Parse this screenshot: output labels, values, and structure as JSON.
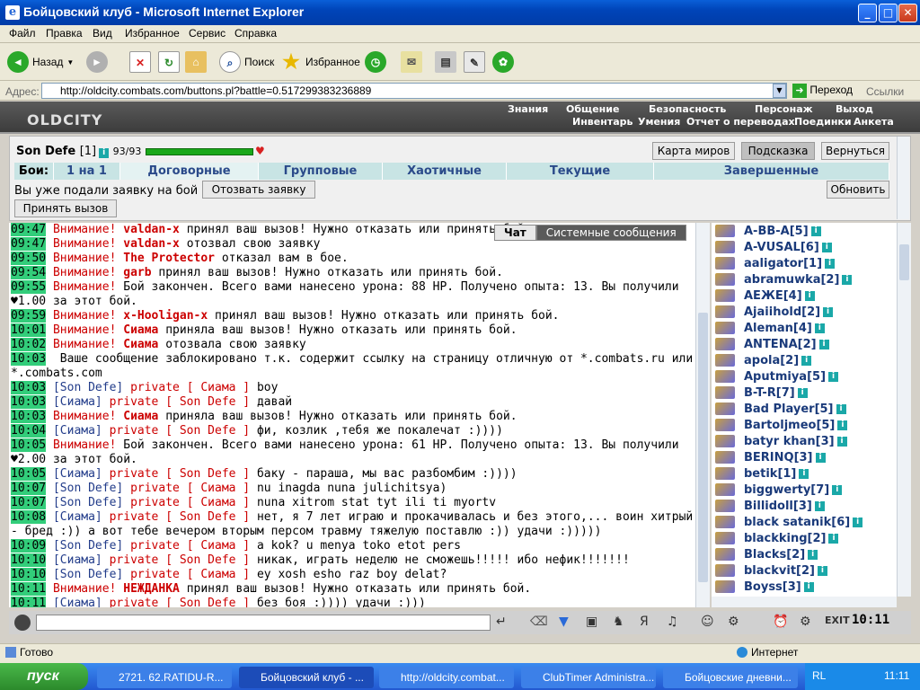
{
  "window": {
    "title": "Бойцовский клуб - Microsoft Internet Explorer"
  },
  "menu": [
    "Файл",
    "Правка",
    "Вид",
    "Избранное",
    "Сервис",
    "Справка"
  ],
  "toolbar": {
    "back": "Назад",
    "search": "Поиск",
    "favorites": "Избранное"
  },
  "address": {
    "label": "Адрес:",
    "url": "http://oldcity.combats.com/buttons.pl?battle=0.517299383236889",
    "go": "Переход",
    "links": "Ссылки"
  },
  "game": {
    "logo": "OLDCITY",
    "nav1": [
      "Знания",
      "Общение",
      "Безопасность",
      "Персонаж",
      "Выход"
    ],
    "nav2": [
      "Инвентарь",
      "Умения",
      "Отчет о переводах",
      "Поединки",
      "Анкета"
    ]
  },
  "player": {
    "name": "Son Defe",
    "level": "[1]",
    "hp": "93/93",
    "hp_fraction": 1.0
  },
  "buttons": {
    "map": "Карта миров",
    "hint": "Подсказка",
    "back": "Вернуться",
    "refresh": "Обновить",
    "withdraw": "Отозвать заявку",
    "accept": "Принять вызов"
  },
  "tabs": {
    "label": "Бои:",
    "items": [
      "1 на 1",
      "Договорные",
      "Групповые",
      "Хаотичные",
      "Текущие",
      "Завершенные"
    ]
  },
  "notice": "Вы уже подали заявку на бой",
  "chattabs": {
    "chat": "Чат",
    "system": "Системные сообщения"
  },
  "chat": [
    {
      "t": "09:47",
      "w": "Внимание!",
      "n": "valdan-x",
      "m": " принял ваш вызов! Нужно отказать или принять бой."
    },
    {
      "t": "09:47",
      "w": "Внимание!",
      "n": "valdan-x",
      "m": " отозвал свою заявку"
    },
    {
      "t": "09:50",
      "w": "Внимание!",
      "n": "The Protector",
      "m": " отказал вам в бое."
    },
    {
      "t": "09:54",
      "w": "Внимание!",
      "n": "garb",
      "m": " принял ваш вызов! Нужно отказать или принять бой."
    },
    {
      "t": "09:55",
      "w": "Внимание!",
      "n": "",
      "m": " Бой закончен. Всего вами нанесено урона: 88 HP. Получено опыта: 13. Вы получили ♥1.00 за этот бой."
    },
    {
      "t": "09:59",
      "w": "Внимание!",
      "n": "x-Hooligan-x",
      "m": " принял ваш вызов! Нужно отказать или принять бой."
    },
    {
      "t": "10:01",
      "w": "Внимание!",
      "n": "Сиама",
      "m": " приняла ваш вызов! Нужно отказать или принять бой."
    },
    {
      "t": "10:02",
      "w": "Внимание!",
      "n": "Сиама",
      "m": " отозвала свою заявку"
    },
    {
      "t": "10:03",
      "w": "",
      "n": "",
      "m": " Ваше сообщение заблокировано т.к. содержит ссылку на страницу отличную от *.combats.ru или *.combats.com"
    },
    {
      "t": "10:03",
      "s": "[Son Defe]",
      "p": "private [ Сиама ]",
      "m": " boy"
    },
    {
      "t": "10:03",
      "s": "[Сиама]",
      "p": "private [ Son Defe ]",
      "m": " давай"
    },
    {
      "t": "10:03",
      "w": "Внимание!",
      "n": "Сиама",
      "m": " приняла ваш вызов! Нужно отказать или принять бой."
    },
    {
      "t": "10:04",
      "s": "[Сиама]",
      "p": "private [ Son Defe ]",
      "m": " фи, козлик ,тебя же покалечат :))))"
    },
    {
      "t": "10:05",
      "w": "Внимание!",
      "n": "",
      "m": " Бой закончен. Всего вами нанесено урона: 61 HP. Получено опыта: 13. Вы получили ♥2.00 за этот бой."
    },
    {
      "t": "10:05",
      "s": "[Сиама]",
      "p": "private [ Son Defe ]",
      "m": " баку - параша, мы вас разбомбим :))))"
    },
    {
      "t": "10:07",
      "s": "[Son Defe]",
      "p": "private [ Сиама ]",
      "m": " nu inagda nuna julichitsya)"
    },
    {
      "t": "10:07",
      "s": "[Son Defe]",
      "p": "private [ Сиама ]",
      "m": " nuna xitrom stat tyt ili ti myortv"
    },
    {
      "t": "10:08",
      "s": "[Сиама]",
      "p": "private [ Son Defe ]",
      "m": " нет, я 7 лет играю и прокачивалась и без этого,... воин хитрый - бред :)) а вот тебе вечером вторым персом травму тяжелую поставлю :)) удачи :)))))"
    },
    {
      "t": "10:09",
      "s": "[Son Defe]",
      "p": "private [ Сиама ]",
      "m": " a kok? u menya toko etot pers"
    },
    {
      "t": "10:10",
      "s": "[Сиама]",
      "p": "private [ Son Defe ]",
      "m": " никак, играть неделю не сможешь!!!!! ибо нефик!!!!!!!"
    },
    {
      "t": "10:10",
      "s": "[Son Defe]",
      "p": "private [ Сиама ]",
      "m": " ey xosh esho raz boy delat?"
    },
    {
      "t": "10:11",
      "w": "Внимание!",
      "n": "НЕЖДАНКА",
      "m": " принял ваш вызов! Нужно отказать или принять бой."
    },
    {
      "t": "10:11",
      "s": "[Сиама]",
      "p": "private [ Son Defe ]",
      "m": " без боя :)))) удачи :)))"
    }
  ],
  "users": [
    "A-BB-A[5]",
    "A-VUSAL[6]",
    "aaligator[1]",
    "abramuwka[2]",
    "AEЖE[4]",
    "Ajaiihold[2]",
    "Aleman[4]",
    "ANTENA[2]",
    "apola[2]",
    "Aputmiya[5]",
    "B-T-R[7]",
    "Bad Player[5]",
    "Bartoljmeo[5]",
    "batyr khan[3]",
    "BERINQ[3]",
    "betik[1]",
    "biggwerty[7]",
    "Billidoll[3]",
    "black satanik[6]",
    "blackking[2]",
    "Blacks[2]",
    "blackvit[2]",
    "Boyss[3]"
  ],
  "clock": "10:11",
  "status": {
    "text": "Готово",
    "zone": "Интернет"
  },
  "taskbar": {
    "start": "пуск",
    "tasks": [
      "2721. 62.RATIDU-R...",
      "Бойцовский клуб - ...",
      "http://oldcity.combat...",
      "ClubTimer Administra...",
      "Бойцовские дневни..."
    ],
    "lang": "RL",
    "time": "11:11"
  }
}
